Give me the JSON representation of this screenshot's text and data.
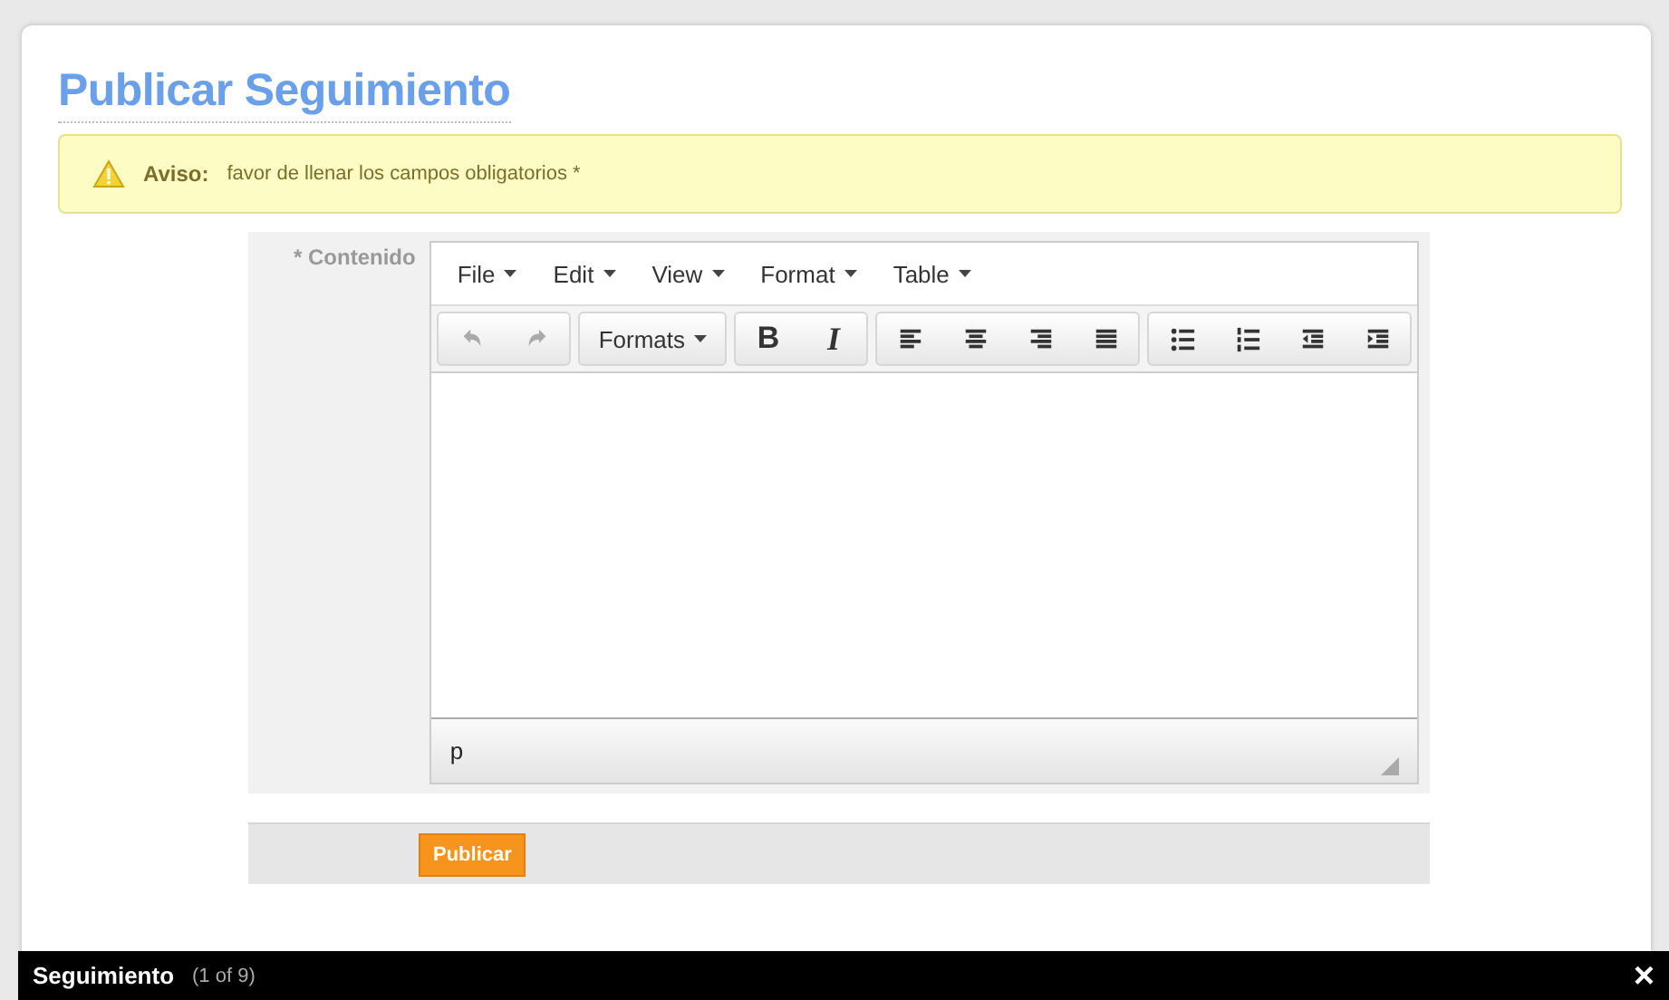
{
  "title": "Publicar Seguimiento",
  "alert": {
    "label": "Aviso:",
    "message": "favor de llenar los campos obligatorios *"
  },
  "field": {
    "label": "* Contenido"
  },
  "editor": {
    "menus": [
      "File",
      "Edit",
      "View",
      "Format",
      "Table"
    ],
    "history": [
      {
        "disabled": true
      },
      {
        "disabled": true
      }
    ],
    "formats": "Formats",
    "bold": "B",
    "italic": "I",
    "path": "p"
  },
  "submit": "Publicar",
  "gallery": {
    "title": "Seguimiento",
    "counter": "(1 of 9)",
    "close": "×"
  }
}
